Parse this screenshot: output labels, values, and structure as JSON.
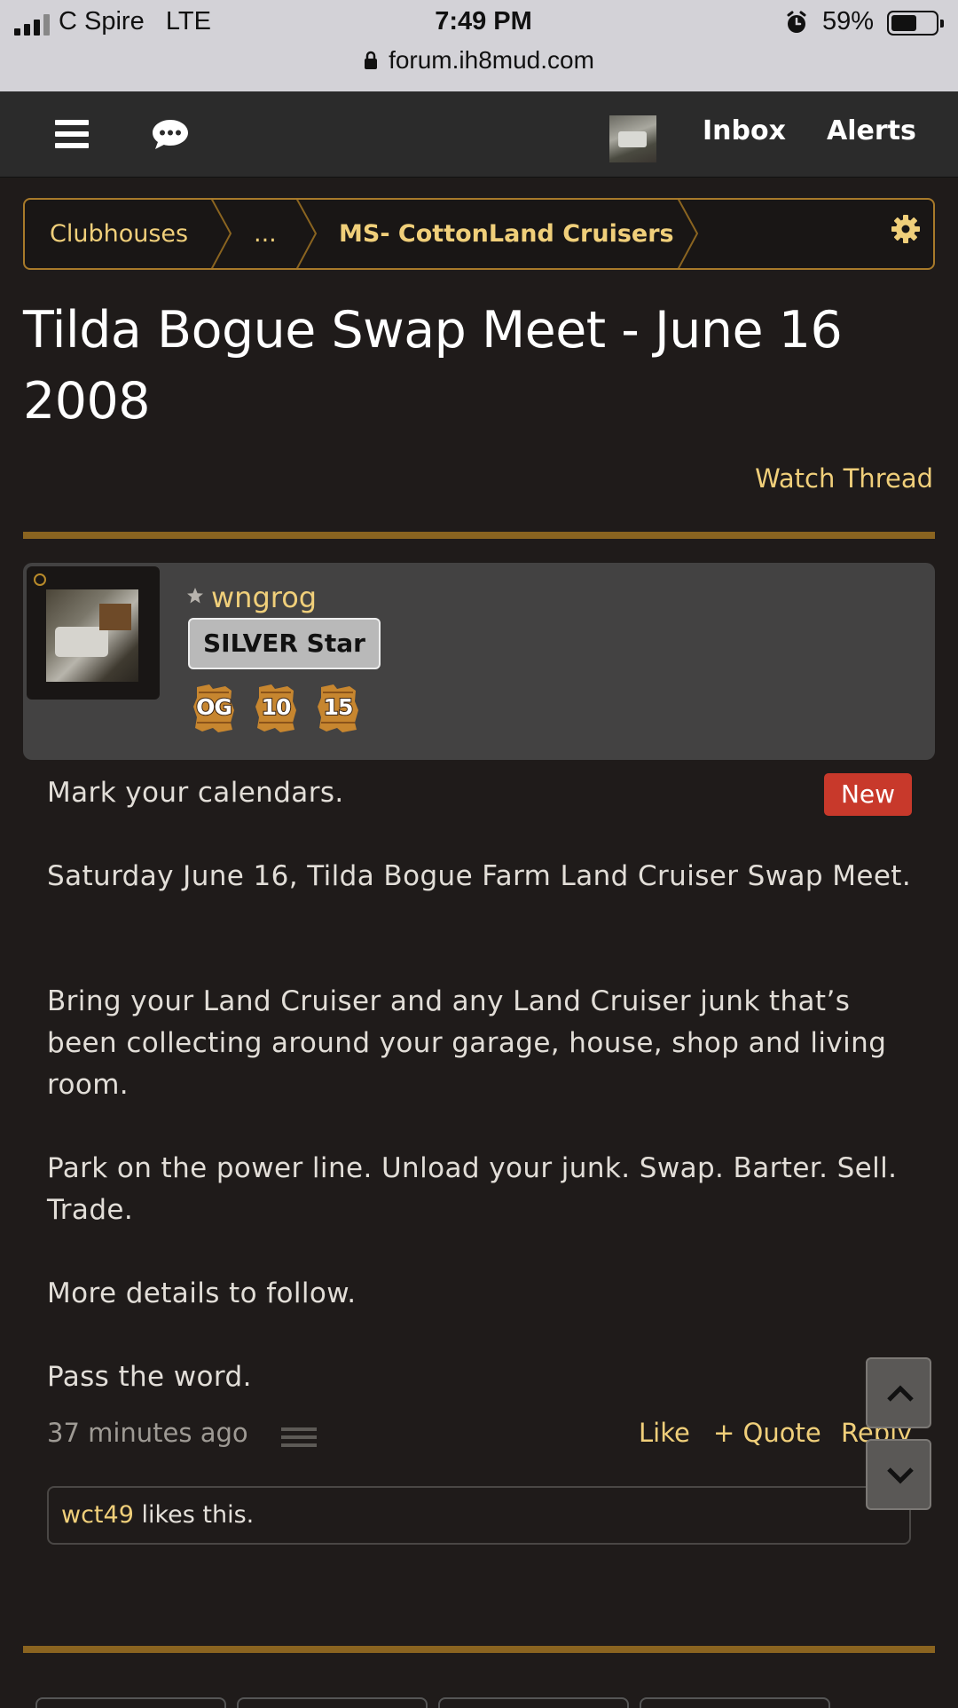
{
  "status_bar": {
    "carrier": "C Spire",
    "network": "LTE",
    "time": "7:49 PM",
    "battery_percent": "59%",
    "battery_level": 0.59,
    "url": "forum.ih8mud.com"
  },
  "nav": {
    "menu_icon": "menu-icon",
    "chat_icon": "chat-bubble-icon",
    "inbox_label": "Inbox",
    "alerts_label": "Alerts"
  },
  "breadcrumb": {
    "items": [
      "Clubhouses",
      "...",
      "MS- CottonLand Cruisers"
    ],
    "settings_icon": "gear-icon"
  },
  "thread": {
    "title": "Tilda Bogue Swap Meet - June 16 2008",
    "watch_label": "Watch Thread"
  },
  "post": {
    "author": "wngrog",
    "rank_badge": "SILVER Star",
    "trophies": [
      "OG",
      "10",
      "15"
    ],
    "new_badge": "New",
    "paragraphs": [
      "Mark your calendars.",
      "Saturday June 16, Tilda Bogue Farm Land Cruiser Swap Meet.",
      "Bring your Land Cruiser and any Land Cruiser junk that’s been collecting around your garage, house, shop and living room.",
      "Park on the power line. Unload your junk. Swap. Barter. Sell. Trade.",
      "More details to follow.",
      "Pass the word."
    ],
    "timestamp": "37 minutes ago",
    "actions": {
      "like": "Like",
      "quote": "+ Quote",
      "reply": "Reply"
    },
    "likes": {
      "user": "wct49",
      "text": "likes this."
    }
  },
  "colors": {
    "background": "#1f1b1a",
    "accent_link": "#f0cf7a",
    "rule": "#8a6420",
    "new_badge": "#c8392b",
    "nav_bar": "#2b2b2b"
  }
}
